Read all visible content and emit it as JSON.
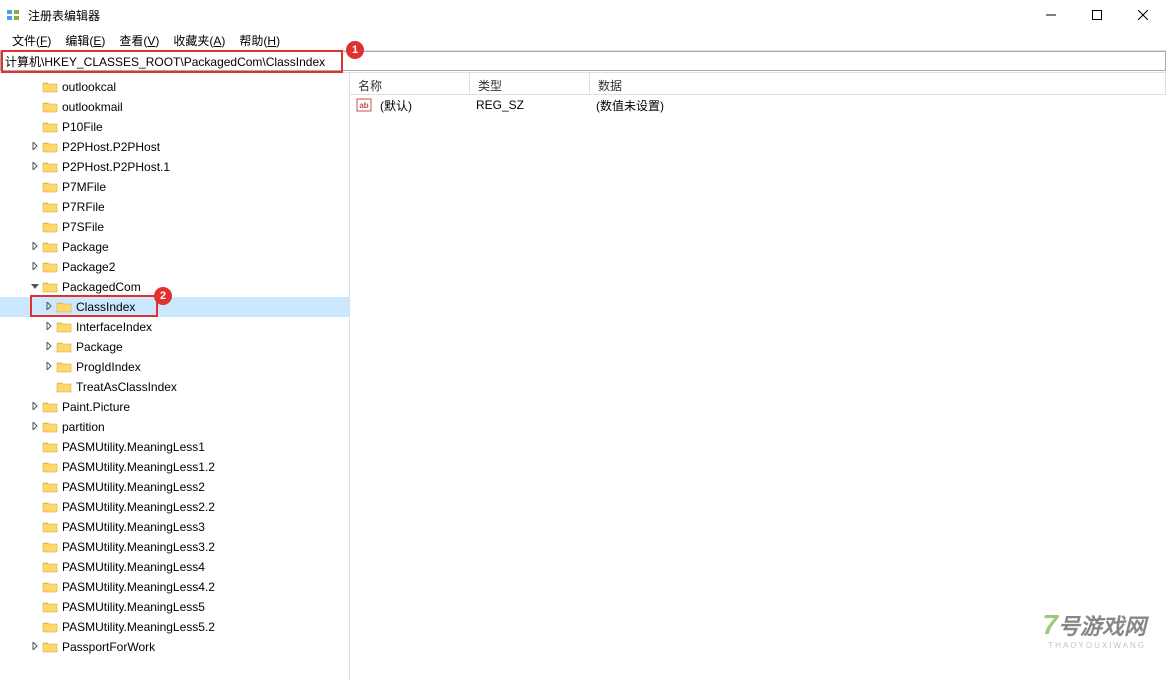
{
  "window": {
    "title": "注册表编辑器"
  },
  "menu": {
    "items": [
      {
        "label": "文件",
        "accel": "F"
      },
      {
        "label": "编辑",
        "accel": "E"
      },
      {
        "label": "查看",
        "accel": "V"
      },
      {
        "label": "收藏夹",
        "accel": "A"
      },
      {
        "label": "帮助",
        "accel": "H"
      }
    ]
  },
  "address": {
    "path": "计算机\\HKEY_CLASSES_ROOT\\PackagedCom\\ClassIndex"
  },
  "callouts": {
    "address": "1",
    "tree": "2"
  },
  "tree": [
    {
      "depth": 2,
      "twisty": "",
      "label": "outlookcal"
    },
    {
      "depth": 2,
      "twisty": "",
      "label": "outlookmail"
    },
    {
      "depth": 2,
      "twisty": "",
      "label": "P10File"
    },
    {
      "depth": 2,
      "twisty": ">",
      "label": "P2PHost.P2PHost"
    },
    {
      "depth": 2,
      "twisty": ">",
      "label": "P2PHost.P2PHost.1"
    },
    {
      "depth": 2,
      "twisty": "",
      "label": "P7MFile"
    },
    {
      "depth": 2,
      "twisty": "",
      "label": "P7RFile"
    },
    {
      "depth": 2,
      "twisty": "",
      "label": "P7SFile"
    },
    {
      "depth": 2,
      "twisty": ">",
      "label": "Package"
    },
    {
      "depth": 2,
      "twisty": ">",
      "label": "Package2"
    },
    {
      "depth": 2,
      "twisty": "v",
      "label": "PackagedCom"
    },
    {
      "depth": 3,
      "twisty": ">",
      "label": "ClassIndex",
      "selected": true
    },
    {
      "depth": 3,
      "twisty": ">",
      "label": "InterfaceIndex"
    },
    {
      "depth": 3,
      "twisty": ">",
      "label": "Package"
    },
    {
      "depth": 3,
      "twisty": ">",
      "label": "ProgIdIndex"
    },
    {
      "depth": 3,
      "twisty": "",
      "label": "TreatAsClassIndex"
    },
    {
      "depth": 2,
      "twisty": ">",
      "label": "Paint.Picture"
    },
    {
      "depth": 2,
      "twisty": ">",
      "label": "partition"
    },
    {
      "depth": 2,
      "twisty": "",
      "label": "PASMUtility.MeaningLess1"
    },
    {
      "depth": 2,
      "twisty": "",
      "label": "PASMUtility.MeaningLess1.2"
    },
    {
      "depth": 2,
      "twisty": "",
      "label": "PASMUtility.MeaningLess2"
    },
    {
      "depth": 2,
      "twisty": "",
      "label": "PASMUtility.MeaningLess2.2"
    },
    {
      "depth": 2,
      "twisty": "",
      "label": "PASMUtility.MeaningLess3"
    },
    {
      "depth": 2,
      "twisty": "",
      "label": "PASMUtility.MeaningLess3.2"
    },
    {
      "depth": 2,
      "twisty": "",
      "label": "PASMUtility.MeaningLess4"
    },
    {
      "depth": 2,
      "twisty": "",
      "label": "PASMUtility.MeaningLess4.2"
    },
    {
      "depth": 2,
      "twisty": "",
      "label": "PASMUtility.MeaningLess5"
    },
    {
      "depth": 2,
      "twisty": "",
      "label": "PASMUtility.MeaningLess5.2"
    },
    {
      "depth": 2,
      "twisty": ">",
      "label": "PassportForWork"
    }
  ],
  "list": {
    "columns": {
      "name": "名称",
      "type": "类型",
      "data": "数据"
    },
    "rows": [
      {
        "name": "(默认)",
        "type": "REG_SZ",
        "data": "(数值未设置)"
      }
    ]
  },
  "watermark": {
    "brand": "7",
    "text": "号游戏网",
    "sub": "THAOYOUXIWANG"
  }
}
